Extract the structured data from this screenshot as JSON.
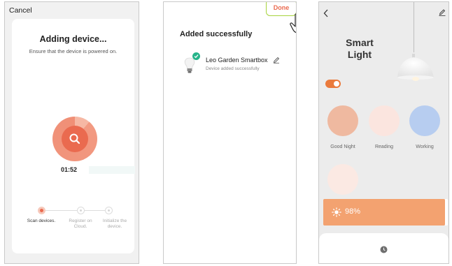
{
  "screen1": {
    "cancel_label": "Cancel",
    "title": "Adding device...",
    "subtitle": "Ensure that the device is powered on.",
    "timer": "01:52",
    "steps": [
      {
        "label": "Scan devices.",
        "state": "active"
      },
      {
        "label": "Register on Cloud.",
        "state": "pending"
      },
      {
        "label": "Initialize the device.",
        "state": "pending"
      }
    ],
    "accent_color": "#ea6a4f"
  },
  "screen2": {
    "done_label": "Done",
    "title": "Added successfully",
    "device": {
      "name": "Leo Garden Smartbox",
      "status": "Device added successfully"
    },
    "icons": [
      "hand-pointer-icon",
      "bulb-icon",
      "check-icon",
      "pencil-icon"
    ]
  },
  "screen3": {
    "title_line1": "Smart",
    "title_line2": "Light",
    "power_on": true,
    "scenes": [
      {
        "label": "Good Night",
        "color": "#efb9a0"
      },
      {
        "label": "Reading",
        "color": "#fbe5df"
      },
      {
        "label": "Working",
        "color": "#b7cdf0"
      },
      {
        "label": "",
        "color": "#fbe9e3"
      }
    ],
    "brightness": "98%",
    "brightness_level": 0.98,
    "icons": [
      "back-icon",
      "edit-icon",
      "sun-icon",
      "clock-icon"
    ]
  }
}
